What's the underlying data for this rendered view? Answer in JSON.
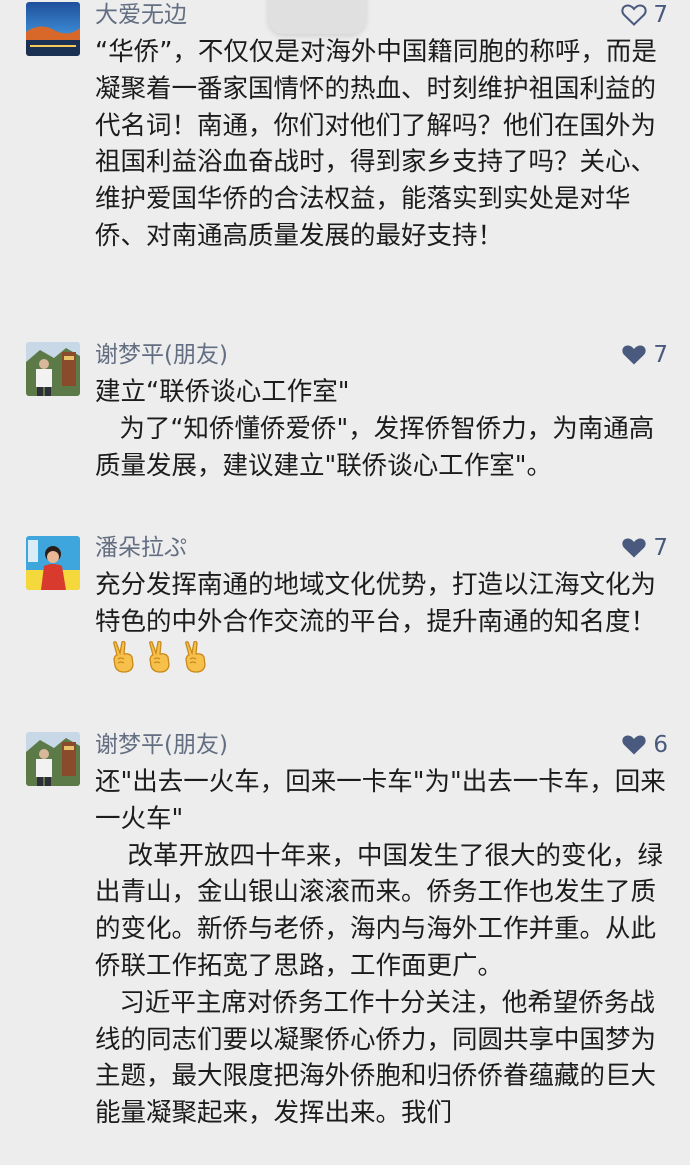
{
  "comments": [
    {
      "author": "大爱无边",
      "likes": "7",
      "liked": false,
      "paragraphs": [
        "“华侨”，不仅仅是对海外中国籍同胞的称呼，而是凝聚着一番家国情怀的热血、时刻维护祖国利益的代名词！南通，你们对他们了解吗？他们在国外为祖国利益浴血奋战时，得到家乡支持了吗？关心、维护爱国华侨的合法权益，能落实到实处是对华侨、对南通高质量发展的最好支持！"
      ]
    },
    {
      "author": "谢梦平(朋友)",
      "likes": "7",
      "liked": true,
      "paragraphs": [
        "建立“联侨谈心工作室\"",
        "   为了“知侨懂侨爱侨\"，发挥侨智侨力，为南通高质量发展，建议建立\"联侨谈心工作室\"。"
      ]
    },
    {
      "author": "潘朵拉ぷ",
      "likes": "7",
      "liked": true,
      "paragraphs": [
        "充分发挥南通的地域文化优势，打造以江海文化为特色的中外合作交流的平台，提升南通的知名度！"
      ],
      "emoji": [
        "victory-hand-emoji",
        "victory-hand-emoji",
        "victory-hand-emoji"
      ]
    },
    {
      "author": "谢梦平(朋友)",
      "likes": "6",
      "liked": true,
      "paragraphs": [
        "还\"出去一火车，回来一卡车\"为\"出去一卡车，回来一火车\"",
        "    改革开放四十年来，中国发生了很大的变化，绿出青山，金山银山滚滚而来。侨务工作也发生了质的变化。新侨与老侨，海内与海外工作并重。从此侨联工作拓宽了思路，工作面更广。",
        "   习近平主席对侨务工作十分关注，他希望侨务战线的同志们要以凝聚侨心侨力，同圆共享中国梦为主题，最大限度把海外侨胞和归侨侨眷蕴藏的巨大能量凝聚起来，发挥出来。我们"
      ]
    }
  ],
  "colors": {
    "background": "#ededed",
    "author": "#646e82",
    "like_accent": "#4a5a7e",
    "text": "#1c1c1c"
  }
}
